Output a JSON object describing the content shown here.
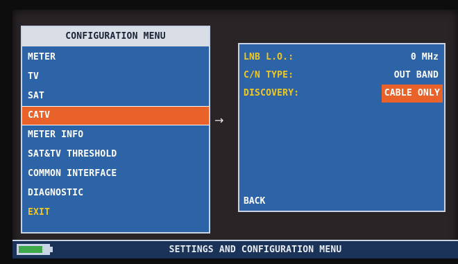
{
  "menu": {
    "title": "CONFIGURATION MENU",
    "items": [
      {
        "label": "METER"
      },
      {
        "label": "TV"
      },
      {
        "label": "SAT"
      },
      {
        "label": "CATV"
      },
      {
        "label": "METER INFO"
      },
      {
        "label": "SAT&TV THRESHOLD"
      },
      {
        "label": "COMMON INTERFACE"
      },
      {
        "label": "DIAGNOSTIC"
      },
      {
        "label": "EXIT"
      }
    ],
    "selected": "CATV"
  },
  "arrow": "→",
  "detail": {
    "rows": [
      {
        "label": "LNB L.O.:",
        "value": "0 MHz"
      },
      {
        "label": "C/N TYPE:",
        "value": "OUT BAND"
      },
      {
        "label": "DISCOVERY:",
        "value": "CABLE ONLY"
      }
    ],
    "back_label": "BACK"
  },
  "status": {
    "text": "SETTINGS AND CONFIGURATION MENU",
    "battery_level": 0.8
  },
  "colors": {
    "panel": "#2d64a8",
    "highlight": "#e8622a",
    "label_yellow": "#f1c81f",
    "battery_green": "#3ea84a"
  },
  "icons": {
    "battery": "battery-icon",
    "arrow": "right-arrow-icon"
  }
}
